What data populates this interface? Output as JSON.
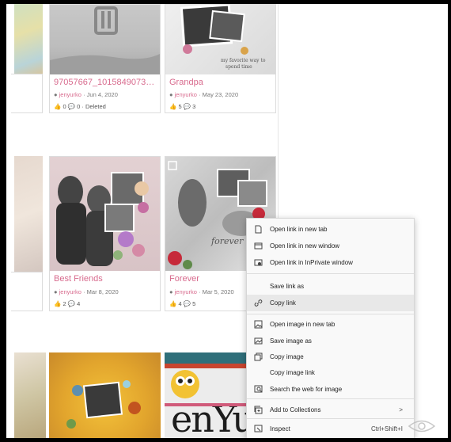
{
  "gallery": {
    "cards": [
      {
        "title": "97057667_1015849073286...",
        "author": "jenyurko",
        "date": "Jun 4, 2020",
        "likes": "0",
        "comments": "0",
        "extra": "Deleted"
      },
      {
        "title": "Grandpa",
        "author": "jenyurko",
        "date": "May 23, 2020",
        "likes": "5",
        "comments": "3"
      },
      {
        "title": "Best Friends",
        "author": "jenyurko",
        "date": "Mar 8, 2020",
        "likes": "2",
        "comments": "4"
      },
      {
        "title": "Forever",
        "author": "jenyurko",
        "date": "Mar 5, 2020",
        "likes": "4",
        "comments": "5"
      }
    ],
    "forever_thumb_text": "forever"
  },
  "context_menu": {
    "items": [
      {
        "label": "Open link in new tab",
        "icon": "new-tab-icon"
      },
      {
        "label": "Open link in new window",
        "icon": "new-window-icon"
      },
      {
        "label": "Open link in InPrivate window",
        "icon": "inprivate-icon"
      },
      {
        "label": "Save link as",
        "icon": ""
      },
      {
        "label": "Copy link",
        "icon": "link-icon"
      },
      {
        "label": "Open image in new tab",
        "icon": "image-tab-icon"
      },
      {
        "label": "Save image as",
        "icon": "save-image-icon"
      },
      {
        "label": "Copy image",
        "icon": "copy-image-icon"
      },
      {
        "label": "Copy image link",
        "icon": ""
      },
      {
        "label": "Search the web for image",
        "icon": "search-image-icon"
      },
      {
        "label": "Add to Collections",
        "icon": "collections-icon",
        "submenu": ">"
      },
      {
        "label": "Inspect",
        "icon": "inspect-icon",
        "shortcut": "Ctrl+Shift+I"
      }
    ],
    "hovered_item": "Copy link"
  }
}
